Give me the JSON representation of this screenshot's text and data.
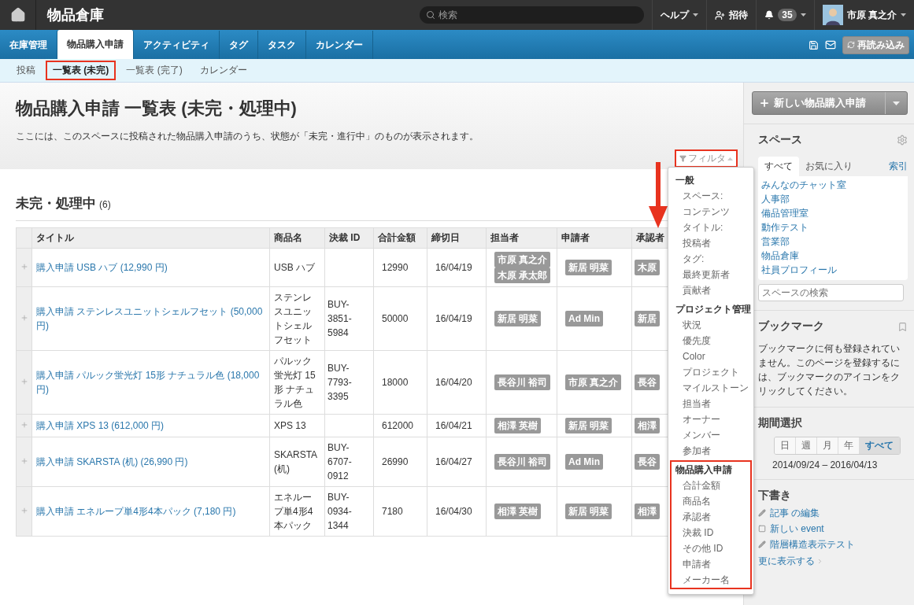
{
  "header": {
    "title": "物品倉庫",
    "search": {
      "placeholder": "検索"
    },
    "help": "ヘルプ",
    "invite": "招待",
    "notifications": "35",
    "user": "市原 真之介"
  },
  "tabs": [
    {
      "label": "在庫管理",
      "selected": false
    },
    {
      "label": "物品購入申請",
      "selected": true
    },
    {
      "label": "アクティビティ",
      "selected": false
    },
    {
      "label": "タグ",
      "selected": false
    },
    {
      "label": "タスク",
      "selected": false
    },
    {
      "label": "カレンダー",
      "selected": false
    }
  ],
  "toolbar": {
    "reload": "再読み込み"
  },
  "subnav": [
    {
      "label": "投稿",
      "selected": false
    },
    {
      "label": "一覧表 (未完)",
      "selected": true
    },
    {
      "label": "一覧表 (完了)",
      "selected": false
    },
    {
      "label": "カレンダー",
      "selected": false
    }
  ],
  "page": {
    "title": "物品購入申請 一覧表 (未完・処理中)",
    "description": "ここには、このスペースに投稿された物品購入申請のうち、状態が「未完・進行中」のものが表示されます。",
    "filter": {
      "label": "フィルタ",
      "highlighted": true
    }
  },
  "section": {
    "title": "未完・処理中",
    "count": "(6)"
  },
  "table": {
    "columns": [
      "タイトル",
      "商品名",
      "決裁 ID",
      "合計金額",
      "締切日",
      "担当者",
      "申請者",
      "承認者"
    ],
    "rows": [
      {
        "title": "購入申請 USB ハブ (12,990 円)",
        "product": "USB ハブ",
        "total": "12990",
        "deadline": "16/04/19",
        "assignees": [
          "市原 真之介",
          "木原 承太郎"
        ],
        "applicants": [
          "新居 明菜"
        ],
        "approvers": [
          "木原"
        ]
      },
      {
        "title": "購入申請 ステンレスユニットシェルフセット (50,000 円)",
        "product": "ステンレスユニットシェルフセット",
        "payment_id": "BUY-3851-5984",
        "total": "50000",
        "deadline": "16/04/19",
        "assignees": [
          "新居 明菜"
        ],
        "applicants": [
          "Ad Min"
        ],
        "approvers": [
          "新居"
        ]
      },
      {
        "title": "購入申請 パルック蛍光灯 15形 ナチュラル色 (18,000 円)",
        "product": "パルック蛍光灯 15形 ナチュラル色",
        "payment_id": "BUY-7793-3395",
        "total": "18000",
        "deadline": "16/04/20",
        "assignees": [
          "長谷川 裕司"
        ],
        "applicants": [
          "市原 真之介"
        ],
        "approvers": [
          "長谷"
        ]
      },
      {
        "title": "購入申請 XPS 13 (612,000 円)",
        "product": "XPS 13",
        "total": "612000",
        "deadline": "16/04/21",
        "assignees": [
          "相澤 英樹"
        ],
        "applicants": [
          "新居 明菜"
        ],
        "approvers": [
          "相澤"
        ]
      },
      {
        "title": "購入申請 SKARSTA (机) (26,990 円)",
        "product": "SKARSTA (机)",
        "payment_id": "BUY-6707-0912",
        "total": "26990",
        "deadline": "16/04/27",
        "assignees": [
          "長谷川 裕司"
        ],
        "applicants": [
          "Ad Min"
        ],
        "approvers": [
          "長谷"
        ]
      },
      {
        "title": "購入申請 エネループ単4形4本パック (7,180 円)",
        "product": "エネループ単4形4本パック",
        "payment_id": "BUY-0934-1344",
        "total": "7180",
        "deadline": "16/04/30",
        "assignees": [
          "相澤 英樹"
        ],
        "applicants": [
          "新居 明菜"
        ],
        "approvers": [
          "相澤"
        ]
      }
    ]
  },
  "filter_menu": {
    "groups": [
      {
        "heading": "一般",
        "highlighted": false,
        "items": [
          "スペース:",
          "コンテンツ",
          "タイトル:",
          "投稿者",
          "タグ:",
          "最終更新者",
          "貢献者"
        ]
      },
      {
        "heading": "プロジェクト管理",
        "highlighted": false,
        "items": [
          "状況",
          "優先度",
          "Color",
          "プロジェクト",
          "マイルストーン",
          "担当者",
          "オーナー",
          "メンバー",
          "参加者"
        ]
      },
      {
        "heading": "物品購入申請",
        "highlighted": true,
        "items": [
          "合計金額",
          "商品名",
          "承認者",
          "決裁 ID",
          "その他 ID",
          "申請者",
          "メーカー名"
        ]
      }
    ]
  },
  "sidebar": {
    "new_button": "新しい物品購入申請",
    "spaces": {
      "title": "スペース",
      "tabs": [
        {
          "label": "すべて",
          "selected": true
        },
        {
          "label": "お気に入り",
          "selected": false
        }
      ],
      "index": "索引",
      "items": [
        "みんなのチャット室",
        "人事部",
        "備品管理室",
        "動作テスト",
        "営業部",
        "物品倉庫",
        "社員プロフィール"
      ],
      "search": {
        "placeholder": "スペースの検索"
      }
    },
    "bookmarks": {
      "title": "ブックマーク",
      "text": "ブックマークに何も登録されていません。このページを登録するには、ブックマークのアイコンをクリックしてください。"
    },
    "period": {
      "title": "期間選択",
      "options": [
        {
          "label": "日",
          "selected": false
        },
        {
          "label": "週",
          "selected": false
        },
        {
          "label": "月",
          "selected": false
        },
        {
          "label": "年",
          "selected": false
        },
        {
          "label": "すべて",
          "selected": true
        }
      ],
      "range": "2014/09/24 – 2016/04/13"
    },
    "drafts": {
      "title": "下書き",
      "items": [
        {
          "kind": "edit",
          "label": "記事 の編集"
        },
        {
          "kind": "new",
          "label": "新しい event"
        },
        {
          "kind": "edit",
          "label": "階層構造表示テスト"
        }
      ],
      "more": "更に表示する"
    }
  }
}
